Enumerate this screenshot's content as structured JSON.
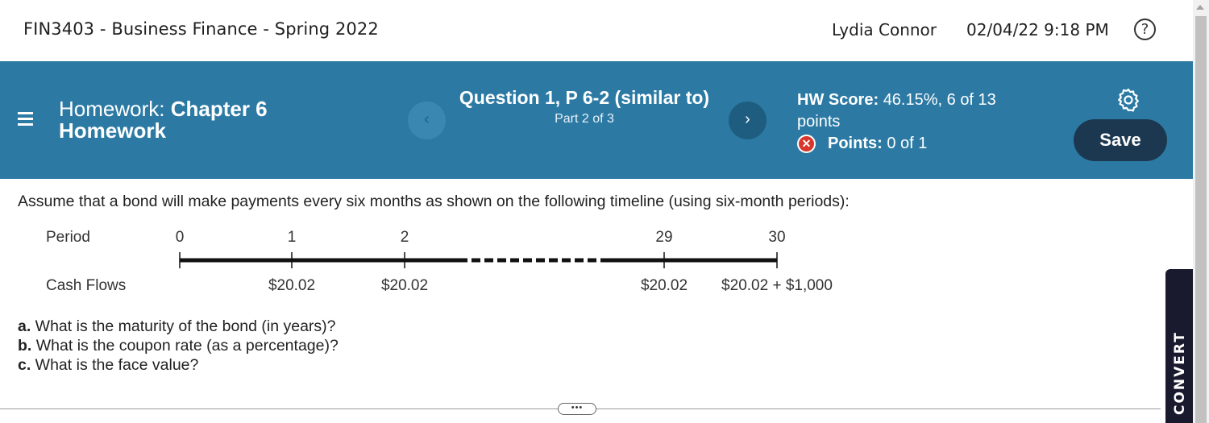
{
  "header": {
    "course_title": "FIN3403 - Business Finance - Spring 2022",
    "user_name": "Lydia Connor",
    "datetime": "02/04/22 9:18 PM",
    "help_glyph": "?"
  },
  "band": {
    "homework_prefix": "Homework:",
    "homework_name_1": "Chapter 6",
    "homework_name_2": "Homework",
    "prev_glyph": "‹",
    "next_glyph": "›",
    "question_title": "Question 1, P 6-2 (similar to)",
    "question_part": "Part 2 of 3",
    "hw_score_label": "HW Score:",
    "hw_score_value": "46.15%, 6 of 13 points",
    "points_label": "Points:",
    "points_value": "0 of 1",
    "save_label": "Save"
  },
  "content": {
    "prompt": "Assume that a bond will make payments every six months as shown on the following timeline (using six-month periods):",
    "timeline": {
      "period_label": "Period",
      "cashflow_label": "Cash Flows",
      "periods": [
        "0",
        "1",
        "2",
        "29",
        "30"
      ],
      "cash_flows": [
        "",
        "$20.02",
        "$20.02",
        "$20.02",
        "$20.02 + $1,000"
      ]
    },
    "questions": [
      {
        "letter": "a.",
        "text": " What is the maturity of the bond (in years)?"
      },
      {
        "letter": "b.",
        "text": " What is the coupon rate (as a percentage)?"
      },
      {
        "letter": "c.",
        "text": " What is the face value?"
      }
    ],
    "more_glyph": "•••"
  },
  "side_tab": {
    "label": "CONVERT"
  },
  "icons": [
    "menu-icon",
    "chevron-left-icon",
    "chevron-right-icon",
    "help-icon",
    "gear-icon",
    "x-circle-icon"
  ],
  "colors": {
    "band": "#2c7aa4",
    "save_button": "#1c3850",
    "error_red": "#d9372b"
  }
}
